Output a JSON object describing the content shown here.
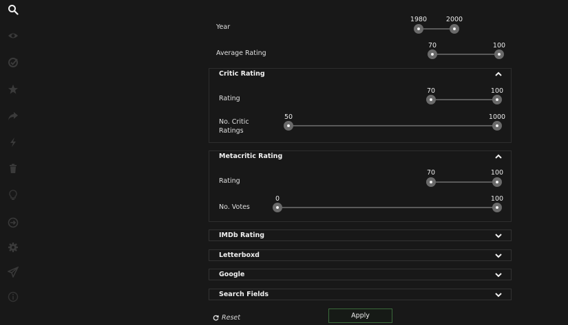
{
  "sidebar": {
    "icons": [
      "search-icon",
      "eye-icon",
      "check-circle-icon",
      "star-icon",
      "share-icon",
      "lightning-icon",
      "trash-icon",
      "lightbulb-icon",
      "sign-in-icon",
      "gear-icon",
      "send-icon",
      "info-icon"
    ]
  },
  "filters": {
    "year": {
      "label": "Year",
      "min": "1980",
      "max": "2000"
    },
    "avg_rating": {
      "label": "Average Rating",
      "min": "70",
      "max": "100"
    }
  },
  "critic": {
    "title": "Critic Rating",
    "rating": {
      "label": "Rating",
      "min": "70",
      "max": "100"
    },
    "count": {
      "label_line1": "No. Critic",
      "label_line2": "Ratings",
      "min": "50",
      "max": "1000"
    }
  },
  "metacritic": {
    "title": "Metacritic Rating",
    "rating": {
      "label": "Rating",
      "min": "70",
      "max": "100"
    },
    "votes": {
      "label": "No. Votes",
      "min": "0",
      "max": "100"
    }
  },
  "collapsed_panels": {
    "imdb": "IMDb Rating",
    "letterboxd": "Letterboxd",
    "google": "Google",
    "search_fields": "Search Fields"
  },
  "footer": {
    "reset_label": "Reset",
    "apply_label": "Apply"
  },
  "colors": {
    "background": "#181818",
    "apply_border": "#3b6b3b",
    "thumb": "#6a6a6a"
  }
}
